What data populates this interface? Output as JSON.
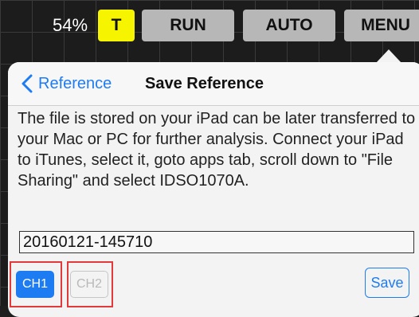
{
  "toolbar": {
    "battery": "54%",
    "t_label": "T",
    "run_label": "RUN",
    "auto_label": "AUTO",
    "menu_label": "MENU"
  },
  "dialog": {
    "back_label": "Reference",
    "title": "Save Reference",
    "description": "The file is stored on your iPad can be later transferred to your Mac or PC for further analysis. Connect your iPad  to iTunes, select it, goto apps tab, scroll down to \"File Sharing\" and select IDSO1070A.",
    "filename": "20160121-145710",
    "ch1_label": "CH1",
    "ch2_label": "CH2",
    "save_label": "Save"
  },
  "colors": {
    "accent": "#1e7cf2",
    "t_button": "#f7f400",
    "highlight_frame": "#e23a3a"
  }
}
